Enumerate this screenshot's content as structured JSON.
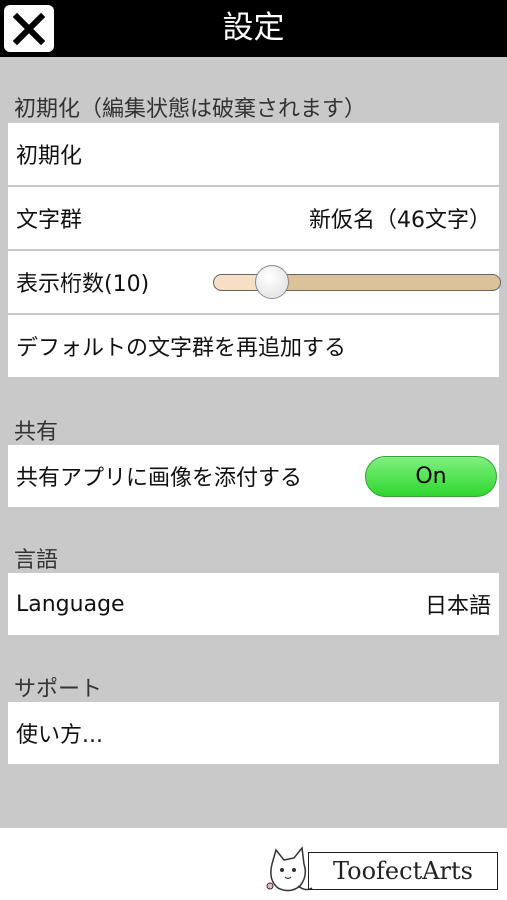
{
  "header": {
    "title": "設定",
    "close_icon": "close-icon"
  },
  "sections": {
    "reset": {
      "label": "初期化（編集状態は破棄されます）",
      "reset_row": "初期化",
      "charset_row": {
        "label": "文字群",
        "value": "新仮名（46文字）"
      },
      "digits_row": {
        "label": "表示桁数(10)",
        "slider_fraction": 0.2
      },
      "readd_row": "デフォルトの文字群を再追加する"
    },
    "share": {
      "label": "共有",
      "attach_row": {
        "label": "共有アプリに画像を添付する",
        "toggle": "On",
        "toggle_color": "#3ddb3d"
      }
    },
    "language": {
      "label": "言語",
      "language_row": {
        "label": "Language",
        "value": "日本語"
      }
    },
    "support": {
      "label": "サポート",
      "howto_row": "使い方..."
    }
  },
  "footer": {
    "logo_text": "ToofectArts"
  }
}
